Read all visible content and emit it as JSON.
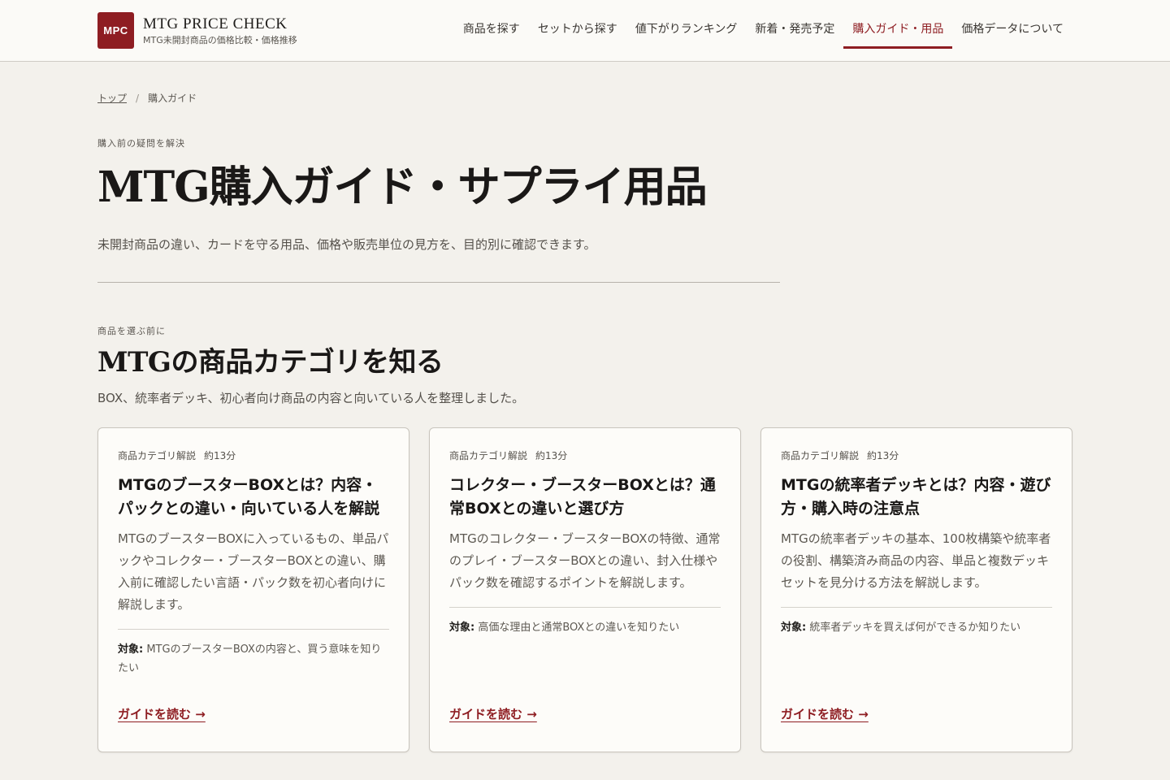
{
  "header": {
    "logo_text": "MPC",
    "site_name": "MTG PRICE CHECK",
    "tagline": "MTG未開封商品の価格比較・価格推移",
    "nav": [
      {
        "label": "商品を探す"
      },
      {
        "label": "セットから探す"
      },
      {
        "label": "値下がりランキング"
      },
      {
        "label": "新着・発売予定"
      },
      {
        "label": "購入ガイド・用品",
        "active": true
      },
      {
        "label": "価格データについて"
      }
    ]
  },
  "breadcrumb": {
    "home": "トップ",
    "separator": "/",
    "current": "購入ガイド"
  },
  "hero": {
    "eyebrow": "購入前の疑問を解決",
    "title": "MTG購入ガイド・サプライ用品",
    "lead": "未開封商品の違い、カードを守る用品、価格や販売単位の見方を、目的別に確認できます。"
  },
  "section": {
    "eyebrow": "商品を選ぶ前に",
    "title": "MTGの商品カテゴリを知る",
    "lead": "BOX、統率者デッキ、初心者向け商品の内容と向いている人を整理しました。"
  },
  "cards": [
    {
      "category": "商品カテゴリ解説",
      "read_time": "約13分",
      "title": "MTGのブースターBOXとは？内容・パックとの違い・向いている人を解説",
      "description": "MTGのブースターBOXに入っているもの、単品パックやコレクター・ブースターBOXとの違い、購入前に確認したい言語・パック数を初心者向けに解説します。",
      "target_label": "対象:",
      "target_text": "MTGのブースターBOXの内容と、買う意味を知りたい",
      "link_label": "ガイドを読む →"
    },
    {
      "category": "商品カテゴリ解説",
      "read_time": "約13分",
      "title": "コレクター・ブースターBOXとは？通常BOXとの違いと選び方",
      "description": "MTGのコレクター・ブースターBOXの特徴、通常のプレイ・ブースターBOXとの違い、封入仕様やパック数を確認するポイントを解説します。",
      "target_label": "対象:",
      "target_text": "高価な理由と通常BOXとの違いを知りたい",
      "link_label": "ガイドを読む →"
    },
    {
      "category": "商品カテゴリ解説",
      "read_time": "約13分",
      "title": "MTGの統率者デッキとは？内容・遊び方・購入時の注意点",
      "description": "MTGの統率者デッキの基本、100枚構築や統率者の役割、構築済み商品の内容、単品と複数デッキセットを見分ける方法を解説します。",
      "target_label": "対象:",
      "target_text": "統率者デッキを買えば何ができるか知りたい",
      "link_label": "ガイドを読む →"
    }
  ],
  "colors": {
    "accent": "#8e1d22",
    "background": "#f3f1ec",
    "card_background": "#fdfcf9"
  }
}
